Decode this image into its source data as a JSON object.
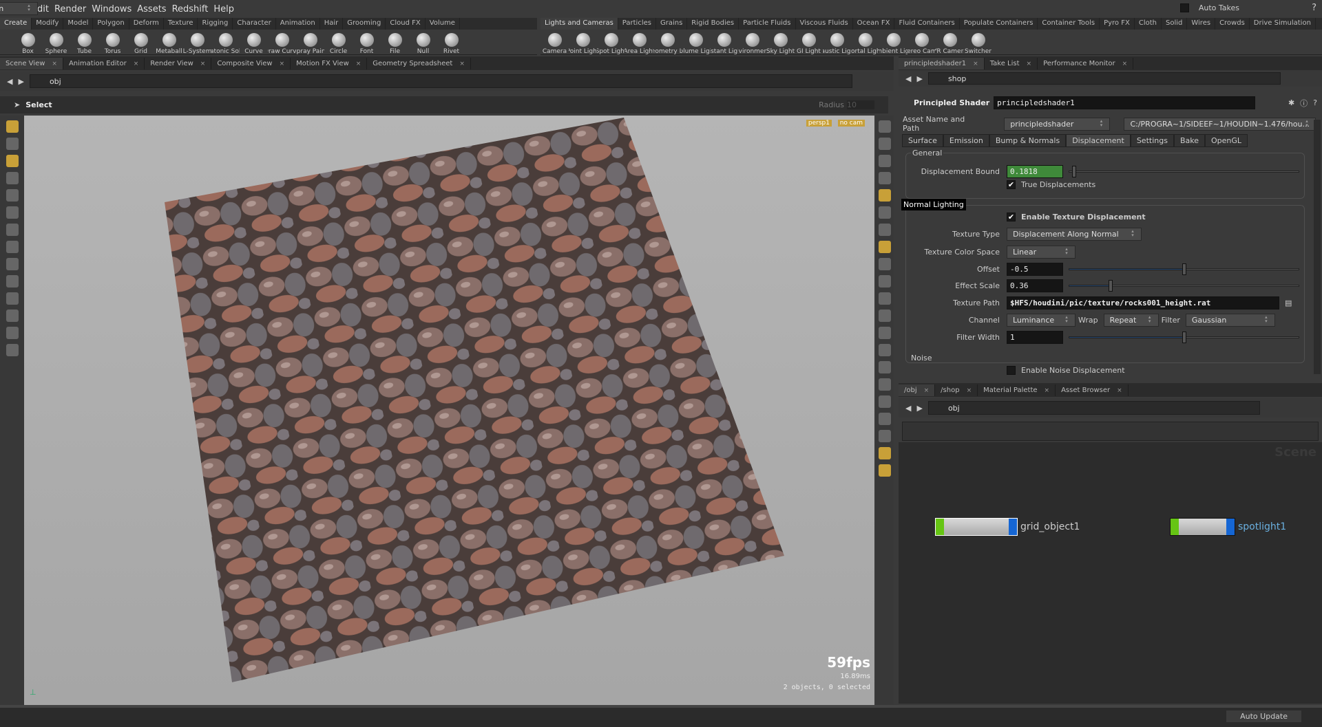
{
  "menu": [
    "File",
    "Edit",
    "Render",
    "Windows",
    "Assets",
    "Redshift",
    "Help"
  ],
  "top_right": {
    "auto_takes": "Auto Takes",
    "take": "Main"
  },
  "shelf_left": {
    "tabs": [
      "Create",
      "Modify",
      "Model",
      "Polygon",
      "Deform",
      "Texture",
      "Rigging",
      "Character",
      "Animation",
      "Hair",
      "Grooming",
      "Cloud FX",
      "Volume"
    ],
    "tools": [
      "Box",
      "Sphere",
      "Tube",
      "Torus",
      "Grid",
      "Metaball",
      "L-System",
      "Platonic Sol...",
      "Curve",
      "Draw Curve",
      "Spray Paint",
      "Circle",
      "Font",
      "File",
      "Null",
      "Rivet"
    ]
  },
  "shelf_right": {
    "tabs": [
      "Lights and Cameras",
      "Particles",
      "Grains",
      "Rigid Bodies",
      "Particle Fluids",
      "Viscous Fluids",
      "Ocean FX",
      "Fluid Containers",
      "Populate Containers",
      "Container Tools",
      "Pyro FX",
      "Cloth",
      "Solid",
      "Wires",
      "Crowds",
      "Drive Simulation"
    ],
    "tools": [
      "Camera",
      "Point Light",
      "Spot Light",
      "Area Light",
      "Geometry L...",
      "Volume Light",
      "Distant Light",
      "Environmen...",
      "Sky Light",
      "GI Light",
      "Caustic Light",
      "Portal Light",
      "Ambient Lig...",
      "Stereo Cam...",
      "VR Camera",
      "Switcher"
    ]
  },
  "left_pane": {
    "tabs": [
      "Scene View",
      "Animation Editor",
      "Render View",
      "Composite View",
      "Motion FX View",
      "Geometry Spreadsheet"
    ],
    "path": "obj",
    "tool": "Select",
    "radius_label": "Radius",
    "radius_value": "10",
    "camera": "persp1",
    "cam_menu": "no cam",
    "fps": "59fps",
    "ms": "16.89ms",
    "selection": "2 objects, 0 selected"
  },
  "tooltip": "Normal Lighting",
  "parm_pane": {
    "tabs": [
      "principledshader1",
      "Take List",
      "Performance Monitor"
    ],
    "path": "shop",
    "node_type": "Principled Shader",
    "node_name": "principledshader1",
    "asset_label": "Asset Name and Path",
    "asset_name": "principledshader",
    "asset_path": "C:/PROGRA~1/SIDEEF~1/HOUDIN~1.476/hou...",
    "tabs2": [
      "Surface",
      "Emission",
      "Bump & Normals",
      "Displacement",
      "Settings",
      "Bake",
      "OpenGL"
    ],
    "active_tab": "Displacement",
    "general": "General",
    "disp_bound_label": "Displacement Bound",
    "disp_bound": "0.1818",
    "true_disp": "True Displacements",
    "enable_tex": "Enable Texture Displacement",
    "tex_type_label": "Texture Type",
    "tex_type": "Displacement Along Normal",
    "tex_cs_label": "Texture Color Space",
    "tex_cs": "Linear",
    "offset_label": "Offset",
    "offset": "-0.5",
    "offset_frac": 0.5,
    "scale_label": "Effect Scale",
    "scale": "0.36",
    "scale_frac": 0.18,
    "path_label": "Texture Path",
    "tex_path": "$HFS/houdini/pic/texture/rocks001_height.rat",
    "channel_label": "Channel",
    "channel": "Luminance",
    "wrap_label": "Wrap",
    "wrap": "Repeat",
    "filter_label": "Filter",
    "filter": "Gaussian",
    "fw_label": "Filter Width",
    "fw": "1",
    "fw_frac": 0.5,
    "noise": "Noise",
    "enable_noise": "Enable Noise Displacement"
  },
  "net_pane": {
    "tabs": [
      "/obj",
      "/shop",
      "Material Palette",
      "Asset Browser"
    ],
    "path": "obj",
    "watermark": "Scene",
    "nodes": [
      "grid_object1",
      "spotlight1"
    ]
  },
  "status": {
    "auto_update": "Auto Update"
  },
  "colors": {
    "accent": "#c8a038",
    "node_green": "#66c514",
    "node_blue": "#1566d4",
    "field_green": "#3f8a3a"
  }
}
